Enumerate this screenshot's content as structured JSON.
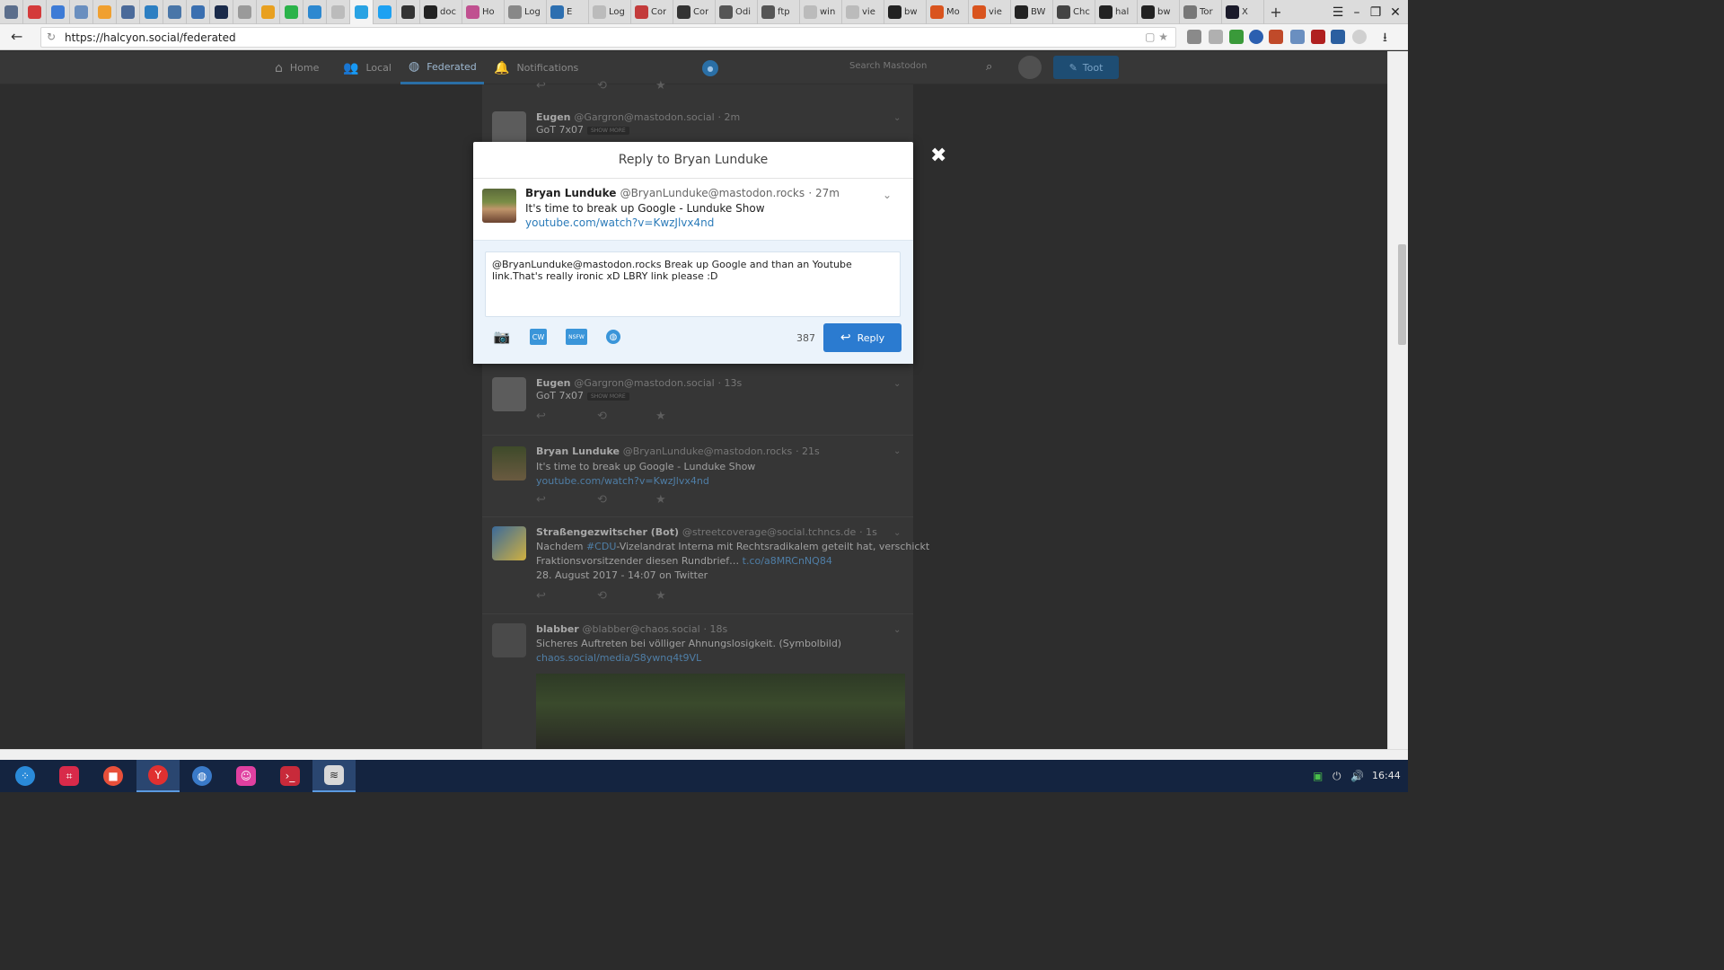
{
  "browser": {
    "tabs": [
      {
        "icon": "mail-icon",
        "color": "#5b6e8c",
        "label": ""
      },
      {
        "icon": "pocket-icon",
        "color": "#d43b3b",
        "label": ""
      },
      {
        "icon": "b-icon",
        "color": "#3d7bd6",
        "label": ""
      },
      {
        "icon": "doc-icon",
        "color": "#6a8fbf",
        "label": ""
      },
      {
        "icon": "57-icon",
        "color": "#f0a030",
        "label": ""
      },
      {
        "icon": "news-icon",
        "color": "#4a6a9a",
        "label": ""
      },
      {
        "icon": "app-icon",
        "color": "#2d7fc2",
        "label": ""
      },
      {
        "icon": "vk-icon",
        "color": "#4a76a8",
        "label": ""
      },
      {
        "icon": "chart-icon",
        "color": "#3a6fb0",
        "label": ""
      },
      {
        "icon": "game-icon",
        "color": "#1a2a4a",
        "label": ""
      },
      {
        "icon": "db-icon",
        "color": "#9a9a9a",
        "label": ""
      },
      {
        "icon": "inbox-icon",
        "color": "#e8a020",
        "label": ""
      },
      {
        "icon": "whatsapp-icon",
        "color": "#2bb34a",
        "label": ""
      },
      {
        "icon": "chat-icon",
        "color": "#2d88d0",
        "label": ""
      },
      {
        "icon": "page-icon",
        "color": "#bbbbbb",
        "label": ""
      },
      {
        "icon": "telegram-icon",
        "color": "#2aa3e3",
        "label": ""
      },
      {
        "icon": "twitter-icon",
        "color": "#1da1f2",
        "label": ""
      },
      {
        "icon": "terminal-icon",
        "color": "#333333",
        "label": ""
      },
      {
        "icon": "github-icon",
        "color": "#222222",
        "label": "doc"
      },
      {
        "icon": "rainbow-icon",
        "color": "#c05090",
        "label": "Ho"
      },
      {
        "icon": "link-icon",
        "color": "#888888",
        "label": "Log"
      },
      {
        "icon": "heart-icon",
        "color": "#2d6fb0",
        "label": "E"
      },
      {
        "icon": "page-icon",
        "color": "#bbbbbb",
        "label": "Log"
      },
      {
        "icon": "circle-icon",
        "color": "#c33b3b",
        "label": "Cor"
      },
      {
        "icon": "dog-icon",
        "color": "#333333",
        "label": "Cor"
      },
      {
        "icon": "code-icon",
        "color": "#555555",
        "label": "Odi"
      },
      {
        "icon": "tools-icon",
        "color": "#555555",
        "label": "ftp"
      },
      {
        "icon": "page-icon",
        "color": "#bbbbbb",
        "label": "win"
      },
      {
        "icon": "page-icon",
        "color": "#bbbbbb",
        "label": "vie"
      },
      {
        "icon": "bw-icon",
        "color": "#222222",
        "label": "bw"
      },
      {
        "icon": "orange-icon",
        "color": "#d9541e",
        "label": "Mo"
      },
      {
        "icon": "orange-icon",
        "color": "#d9541e",
        "label": "vie"
      },
      {
        "icon": "bw-icon",
        "color": "#222222",
        "label": "BW"
      },
      {
        "icon": "gear-icon",
        "color": "#444444",
        "label": "Chc"
      },
      {
        "icon": "github-icon",
        "color": "#222222",
        "label": "hal"
      },
      {
        "icon": "bw-icon",
        "color": "#222222",
        "label": "bw"
      },
      {
        "icon": "tor-icon",
        "color": "#777777",
        "label": "Tor"
      },
      {
        "icon": "xt-icon",
        "color": "#1a1a2a",
        "label": "X"
      }
    ],
    "url": "https://halcyon.social/federated"
  },
  "nav": {
    "home": "Home",
    "local": "Local",
    "federated": "Federated",
    "notifications": "Notifications",
    "search_placeholder": "Search Mastodon",
    "toot": "Toot"
  },
  "timeline": [
    {
      "name": "Eugen",
      "acct": "@Gargron@mastodon.social",
      "time": "· 2m",
      "text": "GoT 7x07",
      "showmore": "SHOW MORE"
    },
    {
      "name": "Eugen",
      "acct": "@Gargron@mastodon.social",
      "time": "· 13s",
      "text": "GoT 7x07",
      "showmore": "SHOW MORE"
    },
    {
      "name": "Bryan Lunduke",
      "acct": "@BryanLunduke@mastodon.rocks",
      "time": "· 21s",
      "text": "It's time to break up Google - Lunduke Show",
      "link": "youtube.com/watch?v=KwzJlvx4nd"
    },
    {
      "name": "Straßengezwitscher (Bot)",
      "acct": "@streetcoverage@social.tchncs.de",
      "time": "· 1s",
      "text_pre": "Nachdem ",
      "hashtag": "#CDU",
      "text_post": "-Vizelandrat Interna mit Rechtsradikalem geteilt hat, verschickt",
      "text2": "Fraktionsvorsitzender diesen Rundbrief… ",
      "link": "t.co/a8MRCnNQ84",
      "text3": "28. August 2017 - 14:07 on Twitter"
    },
    {
      "name": "blabber",
      "acct": "@blabber@chaos.social",
      "time": "· 18s",
      "text": "Sicheres Auftreten bei völliger Ahnungslosigkeit. (Symbolbild)",
      "link": "chaos.social/media/S8ywnq4t9VL"
    }
  ],
  "modal": {
    "title": "Reply to Bryan Lunduke",
    "author": "Bryan Lunduke",
    "acct": "@BryanLunduke@mastodon.rocks",
    "time": "· 27m",
    "text": "It's time to break up Google - Lunduke Show",
    "link": "youtube.com/watch?v=KwzJlvx4nd",
    "reply_text": "@BryanLunduke@mastodon.rocks Break up Google and than an Youtube link.That's really ironic xD LBRY link please :D",
    "cw_label": "CW",
    "nsfw_label": "NSFW",
    "char_count": "387",
    "reply_label": "Reply"
  },
  "taskbar": {
    "clock": "16:44"
  }
}
